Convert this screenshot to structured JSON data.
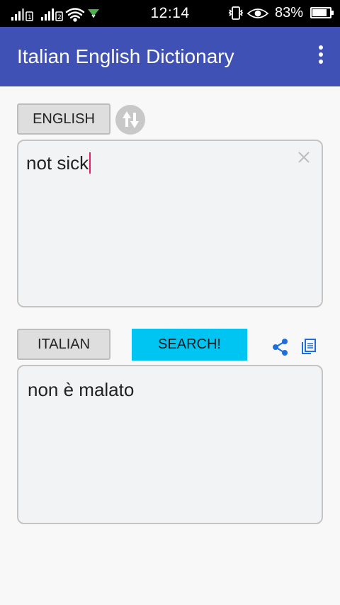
{
  "status_bar": {
    "time": "12:14",
    "battery_percent": "83%",
    "battery_level": 0.83,
    "icons": [
      "signal-icon",
      "sim1-icon",
      "signal-icon",
      "sim2-icon",
      "wifi-icon",
      "download-arrow-icon",
      "vibrate-icon",
      "eye-icon",
      "battery-icon"
    ]
  },
  "app_bar": {
    "title": "Italian English Dictionary",
    "menu_icon": "overflow-menu-icon"
  },
  "source": {
    "language_label": "ENGLISH",
    "input_value": "not sick",
    "clear_icon": "close-icon"
  },
  "swap": {
    "icon": "swap-arrows-icon"
  },
  "target": {
    "language_label": "ITALIAN",
    "search_label": "SEARCH!",
    "output_value": "non è malato",
    "share_icon": "share-icon",
    "copy_icon": "copy-icon"
  },
  "colors": {
    "app_bar": "#3f51b5",
    "search_button": "#00c5f3",
    "action_icons": "#1e6fd9",
    "caret": "#e91e63"
  }
}
